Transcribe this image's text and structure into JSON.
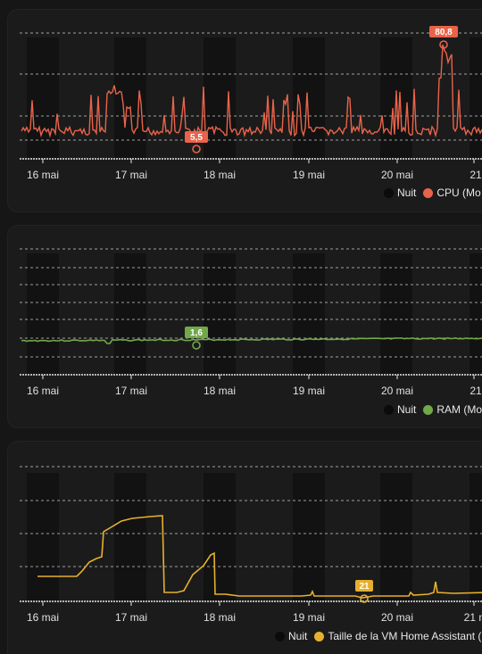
{
  "legend_night_label": "Nuit",
  "colors": {
    "night": "#111111",
    "grid": "#cfcfcf",
    "cpu": "#e8634a",
    "ram": "#72a84a",
    "disk": "#e6b02e"
  },
  "x_ticks": [
    "16 mai",
    "17 mai",
    "18 mai",
    "19 mai",
    "20 mai",
    "21"
  ],
  "chart_data": [
    {
      "type": "line",
      "title": "",
      "x": [
        "16 mai",
        "17 mai",
        "18 mai",
        "19 mai",
        "20 mai",
        "21"
      ],
      "series": [
        {
          "name": "CPU (Mo",
          "color": "#e8634a",
          "annotations": [
            {
              "label": "80,8",
              "kind": "max"
            },
            {
              "label": "5,5",
              "kind": "min"
            }
          ]
        }
      ],
      "legend": [
        "Nuit",
        "CPU (Mo"
      ],
      "legend_position": "bottom-right",
      "grid": true
    },
    {
      "type": "line",
      "title": "",
      "x": [
        "16 mai",
        "17 mai",
        "18 mai",
        "19 mai",
        "20 mai",
        "21"
      ],
      "series": [
        {
          "name": "RAM (Mo",
          "color": "#72a84a",
          "annotations": [
            {
              "label": "1,6",
              "kind": "min"
            }
          ]
        }
      ],
      "legend": [
        "Nuit",
        "RAM (Mo"
      ],
      "legend_position": "bottom-right",
      "grid": true
    },
    {
      "type": "line",
      "title": "",
      "x": [
        "16 mai",
        "17 mai",
        "18 mai",
        "19 mai",
        "20 mai",
        "21 m"
      ],
      "series": [
        {
          "name": "Taille de la VM Home Assistant (",
          "color": "#e6b02e",
          "annotations": [
            {
              "label": "21",
              "kind": "min"
            }
          ]
        }
      ],
      "legend": [
        "Nuit",
        "Taille de la VM Home Assistant ("
      ],
      "legend_position": "bottom-right",
      "grid": true
    }
  ],
  "cards": {
    "cpu": {
      "x_ticks": [
        "16 mai",
        "17 mai",
        "18 mai",
        "19 mai",
        "20 mai",
        "21"
      ],
      "legend_series": "CPU (Mo",
      "max_label": "80,8",
      "min_label": "5,5"
    },
    "ram": {
      "x_ticks": [
        "16 mai",
        "17 mai",
        "18 mai",
        "19 mai",
        "20 mai",
        "21"
      ],
      "legend_series": "RAM (Mo",
      "min_label": "1,6"
    },
    "disk": {
      "x_ticks": [
        "16 mai",
        "17 mai",
        "18 mai",
        "19 mai",
        "20 mai",
        "21 m"
      ],
      "legend_series": "Taille de la VM Home Assistant (",
      "min_label": "21"
    }
  }
}
